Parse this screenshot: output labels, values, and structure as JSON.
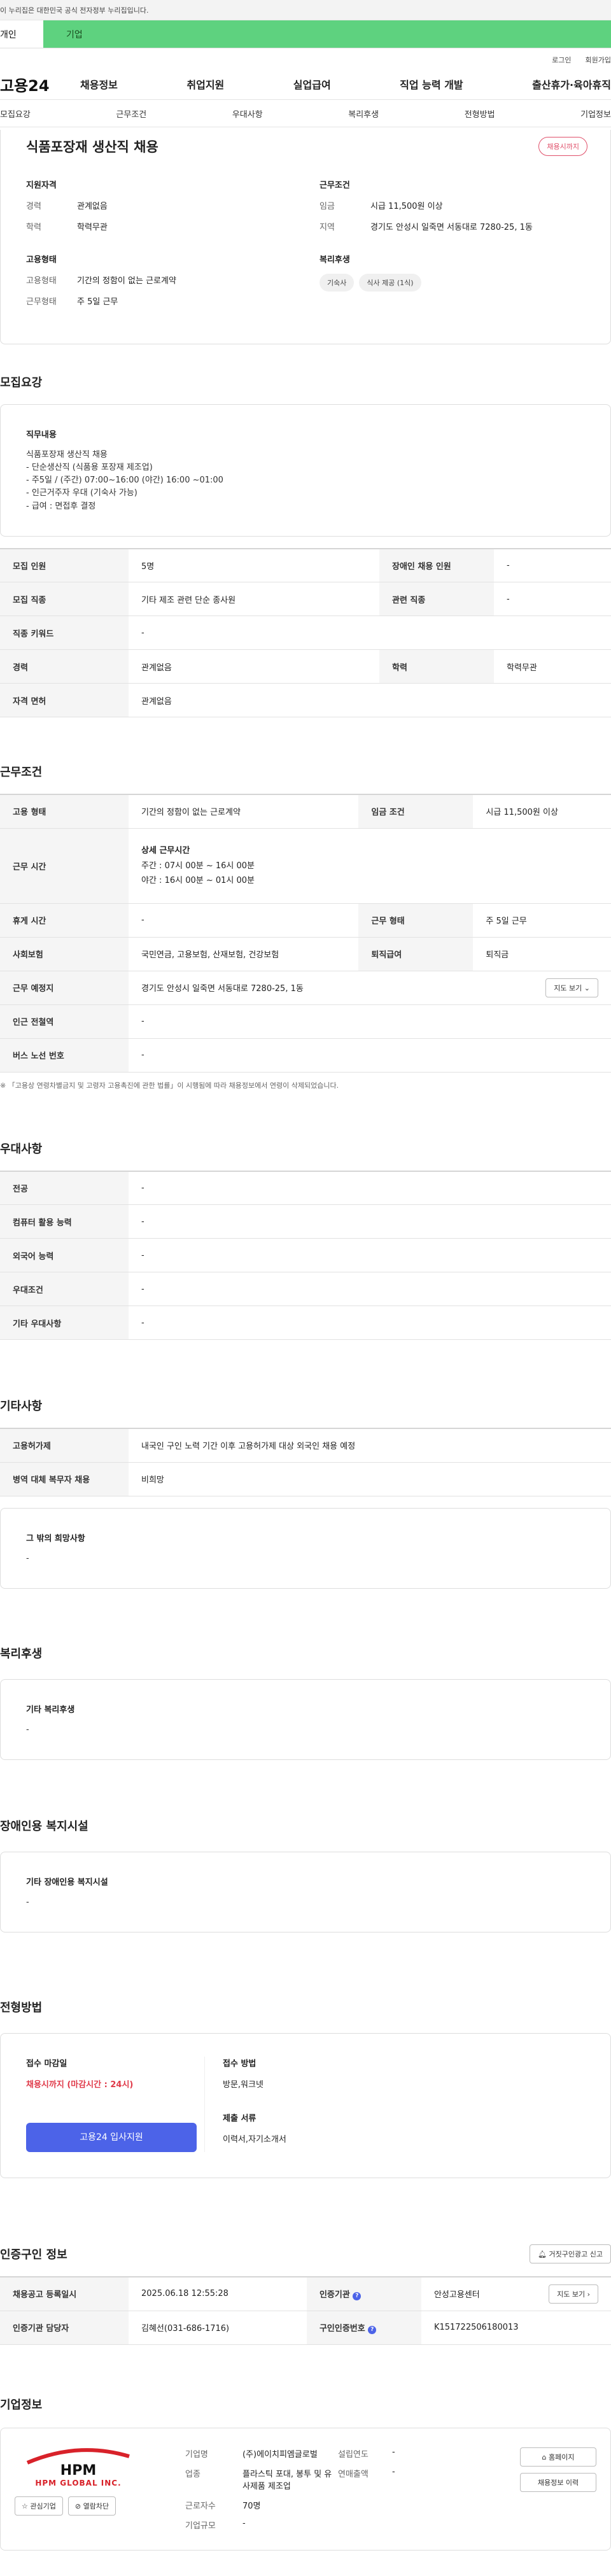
{
  "gov_notice": "이 누리집은 대한민국 공식 전자정부 누리집입니다.",
  "tabs": {
    "individual": "개인",
    "enterprise": "기업"
  },
  "util": {
    "login": "로그인",
    "join": "회원가입"
  },
  "logo": "고용24",
  "gnb": [
    "채용정보",
    "취업지원",
    "실업급여",
    "직업 능력 개발",
    "출산휴가·육아휴직"
  ],
  "subnav": [
    "모집요강",
    "근무조건",
    "우대사항",
    "복리후생",
    "전형방법",
    "기업정보"
  ],
  "job": {
    "title": "식품포장재 생산직 채용",
    "badge": "채용시까지"
  },
  "summary": {
    "qual_title": "지원자격",
    "qual_rows": [
      {
        "k": "경력",
        "v": "관계없음"
      },
      {
        "k": "학력",
        "v": "학력무관"
      }
    ],
    "emp_title": "고용형태",
    "emp_rows": [
      {
        "k": "고용형태",
        "v": "기간의 정함이 없는 근로계약"
      },
      {
        "k": "근무형태",
        "v": "주 5일 근무"
      }
    ],
    "work_title": "근무조건",
    "work_rows": [
      {
        "k": "임금",
        "v": "시급 11,500원 이상"
      },
      {
        "k": "지역",
        "v": "경기도 안성시 일죽면 서동대로 7280-25, 1동"
      }
    ],
    "welfare_title": "복리후생",
    "welfare_chips": [
      "기숙사",
      "식사 제공 (1식)"
    ]
  },
  "recruit": {
    "title": "모집요강",
    "duty_label": "직무내용",
    "duty_text": "식품포장재 생산직 채용\n- 단순생산직 (식품용 포장재 제조업)\n- 주5일 / (주간) 07:00~16:00 (야간) 16:00 ~01:00\n- 인근거주자 우대 (기숙사 가능)\n- 급여 : 면접후 결정",
    "rows": [
      [
        "모집 인원",
        "5명",
        "장애인 채용 인원",
        "-"
      ],
      [
        "모집 직종",
        "기타 제조 관련 단순 종사원",
        "관련 직종",
        "-"
      ],
      [
        "직종 키워드",
        "-",
        "",
        ""
      ],
      [
        "경력",
        "관계없음",
        "학력",
        "학력무관"
      ],
      [
        "자격 면허",
        "관계없음",
        "",
        ""
      ]
    ]
  },
  "work": {
    "title": "근무조건",
    "emp_type_k": "고용 형태",
    "emp_type_v": "기간의 정함이 없는 근로계약",
    "wage_k": "임금 조건",
    "wage_v": "시급 11,500원 이상",
    "hours_k": "근무 시간",
    "hours_title": "상세 근무시간",
    "hours_day": "주간 : 07시 00분 ~ 16시 00분",
    "hours_night": "야간 : 16시 00분 ~ 01시 00분",
    "rest_k": "휴게 시간",
    "rest_v": "-",
    "shift_k": "근무 형태",
    "shift_v": "주 5일 근무",
    "ins_k": "사회보험",
    "ins_v": "국민연금, 고용보험, 산재보험, 건강보험",
    "ret_k": "퇴직급여",
    "ret_v": "퇴직금",
    "loc_k": "근무 예정지",
    "loc_v": "경기도 안성시 일죽면 서동대로 7280-25, 1동",
    "map_btn": "지도 보기",
    "sub_k": "인근 전철역",
    "sub_v": "-",
    "bus_k": "버스 노선 번호",
    "bus_v": "-",
    "note": "※ 「고용상 연령차별금지 및 고령자 고용촉진에 관한 법률」이 시행됨에 따라 채용정보에서 연령이 삭제되었습니다."
  },
  "pref": {
    "title": "우대사항",
    "rows": [
      [
        "전공",
        "-"
      ],
      [
        "컴퓨터 활용 능력",
        "-"
      ],
      [
        "외국어 능력",
        "-"
      ],
      [
        "우대조건",
        "-"
      ],
      [
        "기타 우대사항",
        "-"
      ]
    ]
  },
  "etc": {
    "title": "기타사항",
    "rows": [
      [
        "고용허가제",
        "내국인 구인 노력 기간 이후 고용허가제 대상 외국인 채용 예정"
      ],
      [
        "병역 대체 복무자 채용",
        "비희망"
      ]
    ],
    "other_label": "그 밖의 희망사항",
    "other_v": "-"
  },
  "welfare": {
    "title": "복리후생",
    "label": "기타 복리후생",
    "v": "-"
  },
  "disab": {
    "title": "장애인용 복지시설",
    "label": "기타 장애인용 복지시설",
    "v": "-"
  },
  "screen": {
    "title": "전형방법",
    "deadline_k": "접수 마감일",
    "deadline_v": "채용시까지 (마감시간 : 24시)",
    "apply_btn": "고용24 입사지원",
    "method_k": "접수 방법",
    "method_v": "방문,워크넷",
    "docs_k": "제출 서류",
    "docs_v": "이력서,자기소개서"
  },
  "cert": {
    "title": "인증구인 정보",
    "report_btn": "거짓구인광고 신고",
    "rows": [
      [
        "채용공고 등록일시",
        "2025.06.18 12:55:28",
        "인증기관",
        "안성고용센터"
      ],
      [
        "인증기관 담당자",
        "김혜선(031-686-1716)",
        "구인인증번호",
        "K151722506180013"
      ]
    ],
    "map_btn": "지도 보기"
  },
  "company": {
    "title": "기업정보",
    "logo_main": "HPM",
    "logo_sub": "HPM GLOBAL INC.",
    "fav_btn": "관심기업",
    "block_btn": "열람차단",
    "fields": {
      "name_k": "기업명",
      "name_v": "(주)에이치피엠글로벌",
      "found_k": "설립연도",
      "found_v": "-",
      "ind_k": "업종",
      "ind_v": "플라스틱 포대, 봉투 및 유사제품 제조업",
      "sales_k": "연매출액",
      "sales_v": "-",
      "emp_k": "근로자수",
      "emp_v": "70명",
      "size_k": "기업규모",
      "size_v": "-"
    },
    "home_btn": "홈페이지",
    "hist_btn": "채용정보 이력"
  }
}
